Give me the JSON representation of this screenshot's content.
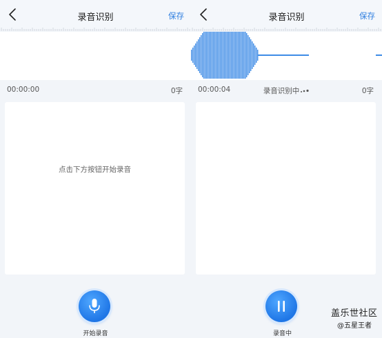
{
  "screens": [
    {
      "nav": {
        "title": "录音识别",
        "save_label": "保存"
      },
      "meta": {
        "time": "00:00:00",
        "status": "",
        "char_count": "0字"
      },
      "hint": "点击下方按钮开始录音",
      "button": {
        "state": "idle",
        "icon": "microphone-icon",
        "label": "开始录音"
      }
    },
    {
      "nav": {
        "title": "录音识别",
        "save_label": "保存"
      },
      "meta": {
        "time": "00:00:04",
        "status": "录音识别中",
        "char_count": "0字"
      },
      "hint": "",
      "button": {
        "state": "recording",
        "icon": "pause-icon",
        "label": "录音中"
      }
    }
  ],
  "watermark": {
    "line1": "盖乐世社区",
    "line2": "@五星王者"
  },
  "colors": {
    "accent": "#2f7fe0",
    "waveform": "#3d8be6",
    "background": "#f2f5f9",
    "card": "#ffffff"
  }
}
